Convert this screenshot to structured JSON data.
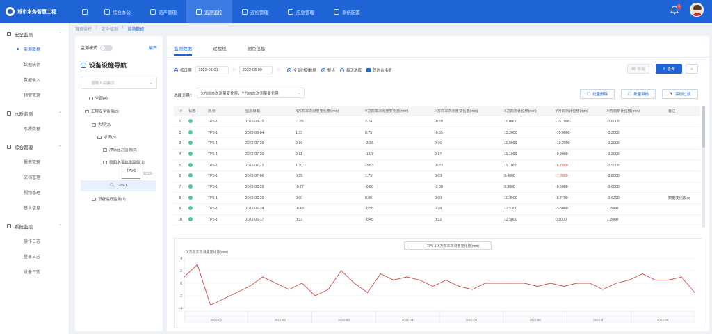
{
  "app": {
    "title": "城市水务智慧工程"
  },
  "nav": [
    "首页",
    "综合办公",
    "资产管理",
    "监测监控",
    "巡检管理",
    "应急管理",
    "系统配置"
  ],
  "nav_active": 3,
  "notifications": "1",
  "sidebar": {
    "groups": [
      {
        "label": "安全监测",
        "items": [
          "监测数据",
          "数据统计",
          "数据录入",
          "预警管理"
        ]
      },
      {
        "label": "水质监测",
        "items": [
          "水质数据"
        ]
      },
      {
        "label": "综合管理",
        "items": [
          "报表管理",
          "文档管理",
          "视频管理",
          "基本信息"
        ]
      },
      {
        "label": "系统监控",
        "items": [
          "操作日志",
          "登录日志",
          "设备日志"
        ]
      }
    ],
    "active": "监测数据"
  },
  "breadcrumb": [
    "首页监控",
    "安全监测",
    "监测数据"
  ],
  "tree": {
    "switch_label": "监测模式",
    "link": "展开",
    "title": "设备设施导航",
    "search_placeholder": "请输入关键词",
    "nodes": [
      "全部(4)",
      "工程安全监测(3)",
      "大坝(3)",
      "渗流(3)",
      "渗流压力监测(2)",
      "表面水平位移监测(1)",
      "TP5-1",
      "设备运行监测(1)"
    ],
    "tooltip": "TP5-1",
    "overflow": "2022-"
  },
  "tabs": [
    "监测数据",
    "过程线",
    "测点信息"
  ],
  "filters": {
    "r1": "按日期",
    "start": "2022-01-01",
    "end": "2022-08-09",
    "r2": "全部时刻数据",
    "r3": "整点",
    "r4": "每天选择",
    "chk": "仅选合格值"
  },
  "buttons": {
    "export": "导出",
    "query": "查询",
    "batch_delete": "批量删除",
    "batch_audit": "批量审核",
    "advanced": "高级过滤"
  },
  "select": {
    "label": "选择分量：",
    "value": "X方向本次测量变化量，Y方向本次测量变化量"
  },
  "table": {
    "headers": [
      "#",
      "状态",
      "测点",
      "监测日期",
      "X方向本次测量变化量(mm)",
      "Y方向本次测量变化量(mm)",
      "H方向本次测量变化量(mm)",
      "X方向累计位移(mm)",
      "Y方向累计位移(mm)",
      "H方向累计位移(mm)",
      "备注"
    ],
    "rows": [
      [
        "1",
        "",
        "TP5-1",
        "2022-08-10",
        "-1.35",
        "2.74",
        "-0.59",
        "10.8000",
        "-10.7000",
        "-3.8000",
        ""
      ],
      [
        "2",
        "",
        "TP5-1",
        "2022-08-04",
        "1.33",
        "0.75",
        "-0.55",
        "13.2000",
        "-10.0000",
        "-3.3000",
        ""
      ],
      [
        "3",
        "",
        "TP5-1",
        "2022-07-29",
        "0.16",
        "-3.36",
        "0.76",
        "11.9000",
        "-10.2000",
        "-3.2000",
        ""
      ],
      [
        "4",
        "",
        "TP5-1",
        "2022-07-20",
        "0.11",
        "-1.07",
        "0.17",
        "11.1000",
        "-9.8000",
        "-3.3000",
        ""
      ],
      [
        "5",
        "",
        "TP5-1",
        "2022-07-12",
        "1.70",
        "-3.83",
        "-0.83",
        "11.1000",
        "-6.7000",
        "-3.9000",
        ""
      ],
      [
        "6",
        "",
        "TP5-1",
        "2022-07-06",
        "0.35",
        "1.75",
        "0.03",
        "9.4000",
        "-7.8000",
        "-2.8000",
        ""
      ],
      [
        "7",
        "",
        "TP5-1",
        "2022-06-29",
        "-0.77",
        "-0.60",
        "-2.00",
        "9.3000",
        "-9.6000",
        "-3.6000",
        ""
      ],
      [
        "8",
        "",
        "TP5-1",
        "2022-06-20",
        "0.00",
        "0.00",
        "0.00",
        "10.3500",
        "-6.7400",
        "-3.6200",
        "数据变化较大"
      ],
      [
        "9",
        "",
        "TP5-1",
        "2022-06-24",
        "-0.43",
        "-0.55",
        "0.28",
        "12.5300",
        "-3.5000",
        "1.2000",
        ""
      ],
      [
        "10",
        "",
        "TP5-1",
        "2022-06-17",
        "0.33",
        "-0.45",
        "0.32",
        "12.5000",
        "0.8000",
        "1.2000",
        ""
      ]
    ],
    "red_cells": [
      [
        4,
        8
      ],
      [
        5,
        8
      ]
    ]
  },
  "chart_data": {
    "type": "line",
    "series": [
      {
        "name": "TP5-1 X方向本次测量变化量(mm)",
        "color": "#d04848",
        "values": [
          1,
          3,
          -3.5,
          -2.5,
          -1.5,
          -0.5,
          1,
          0,
          -1,
          0,
          -2,
          -1,
          2,
          0,
          -1.5,
          1.5,
          0.5,
          1,
          0.5,
          -0.5,
          0.5,
          -0.5,
          -1,
          0,
          0,
          0,
          0,
          -0.5,
          0,
          -0.5,
          0,
          0,
          -1,
          0,
          0.5,
          1.5,
          0.5,
          0.5,
          1,
          -1.5
        ]
      }
    ],
    "ylabel": "X方向本次测量变化量(mm)",
    "ylim": [
      -4,
      4
    ],
    "yticks": [
      "4",
      "2",
      "0",
      "-2",
      "-4"
    ],
    "x_month_labels": [
      "2022-01",
      "2022-02",
      "2022-03",
      "2022-04",
      "2022-05",
      "2022-06",
      "2022-07",
      "2022-08"
    ]
  }
}
